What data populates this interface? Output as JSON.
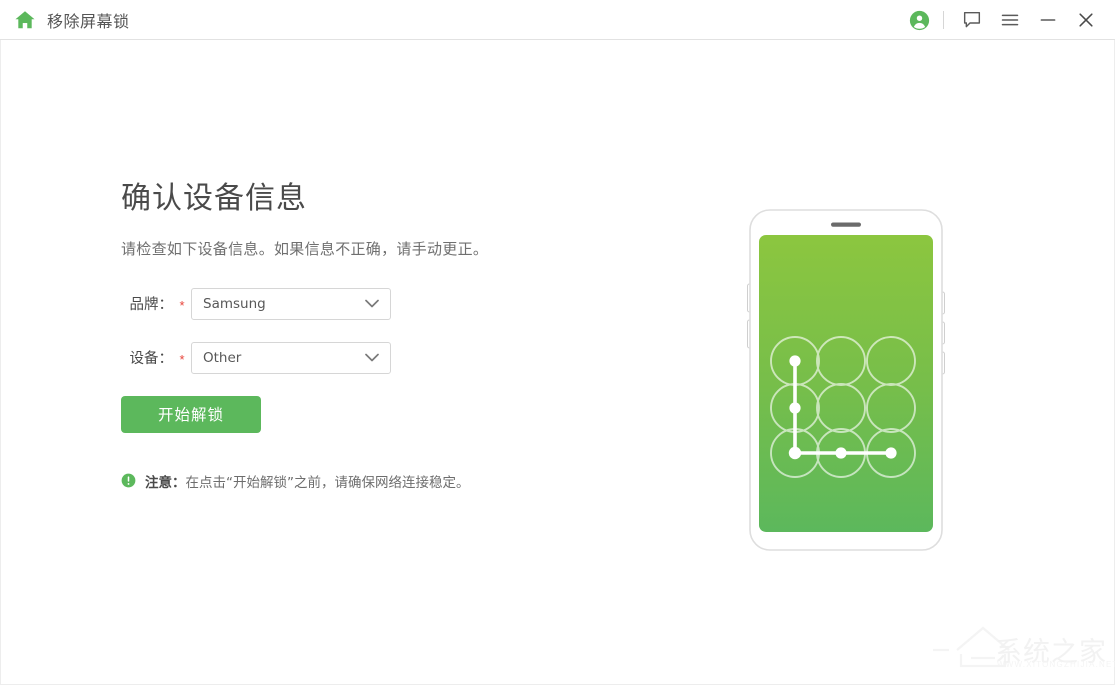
{
  "titlebar": {
    "app_title": "移除屏幕锁",
    "home_icon": "home-icon",
    "account_icon": "account-circle-icon",
    "feedback_icon": "chat-bubble-icon",
    "menu_icon": "hamburger-menu-icon",
    "minimize_icon": "minimize-icon",
    "close_icon": "close-icon",
    "accent_color": "#5cb85c"
  },
  "main": {
    "page_title": "确认设备信息",
    "page_subtitle": "请检查如下设备信息。如果信息不正确，请手动更正。",
    "form": {
      "brand": {
        "label": "品牌：",
        "required_mark": "*",
        "value": "Samsung",
        "placeholder": "Samsung"
      },
      "device": {
        "label": "设备：",
        "required_mark": "*",
        "value": "Other",
        "placeholder": "Other"
      }
    },
    "start_button_label": "开始解锁",
    "note": {
      "icon": "info-exclamation-icon",
      "prefix": "注意：",
      "body": "在点击“开始解锁”之前，请确保网络连接稳定。",
      "icon_color": "#5cb85c"
    }
  },
  "illustration": {
    "name": "phone-pattern-lock-illustration",
    "screen_gradient_top": "#8cc63f",
    "screen_gradient_bottom": "#5cb85c",
    "body_color": "#ffffff",
    "border_color": "#e0e0e0",
    "speaker_color": "#6b6b6b",
    "pattern_path": [
      "top-left",
      "middle-left",
      "bottom-left",
      "bottom-center",
      "bottom-right"
    ]
  },
  "watermark": {
    "text": "系统之家",
    "sub": "WWW.XITONGZHIJIA.NET",
    "color": "#f2f2f2"
  }
}
